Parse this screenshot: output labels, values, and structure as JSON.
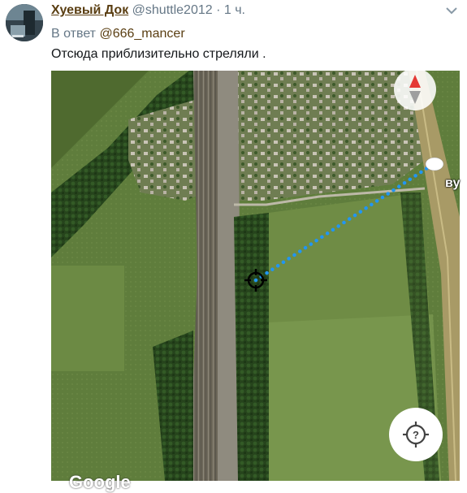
{
  "tweet": {
    "author_name": "Хуевый Док",
    "author_handle": "@shuttle2012",
    "separator": "·",
    "time": "1 ч.",
    "reply_prefix": "В ответ",
    "reply_to": "@666_mancer",
    "text": "Отсюда приблизительно стреляли ."
  },
  "map": {
    "road_label": "ву",
    "watermark": "Google",
    "compass_icon": "compass-needle-icon",
    "locate_icon": "crosshair-question-icon",
    "target_icon": "crosshair-target-icon",
    "route_color": "#2196f3"
  },
  "colors": {
    "author_name": "#5a3e12",
    "secondary_text": "#657786"
  }
}
